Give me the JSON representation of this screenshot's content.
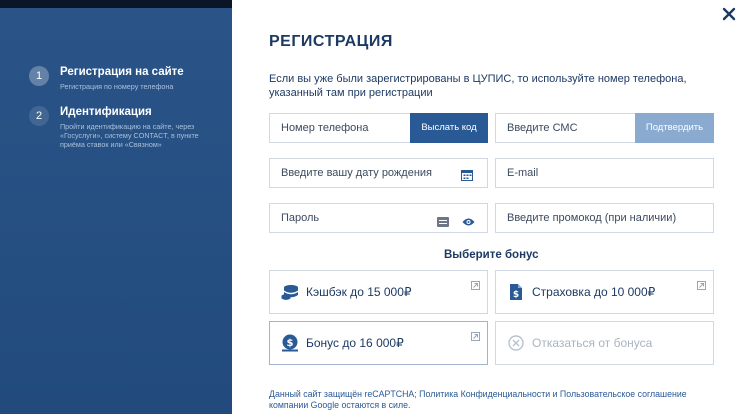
{
  "colors": {
    "sidebar": "#2a5488",
    "primary": "#2a5a96",
    "primary_light": "#8aaad0",
    "text_dark": "#1d3a63",
    "border": "#cfd8e3"
  },
  "sidebar": {
    "steps": [
      {
        "number": "1",
        "title": "Регистрация на сайте",
        "subtitle": "Регистрация по номеру телефона"
      },
      {
        "number": "2",
        "title": "Идентификация",
        "subtitle": "Пройти идентификацию на сайте, через «Госуслуги», систему CONTACT, в пункте приёма ставок или «Связном»"
      }
    ]
  },
  "modal": {
    "title": "РЕГИСТРАЦИЯ",
    "intro": "Если вы уже были зарегистрированы в ЦУПИС, то используйте номер телефона, указанный там при регистрации",
    "close_icon": "close-icon",
    "fields": {
      "phone": {
        "placeholder": "Номер телефона",
        "button": "Выслать код"
      },
      "sms": {
        "placeholder": "Введите СМС",
        "button": "Подтвердить"
      },
      "birthdate": {
        "placeholder": "Введите вашу дату рождения",
        "icon": "calendar-icon"
      },
      "email": {
        "placeholder": "E-mail"
      },
      "password": {
        "placeholder": "Пароль",
        "icon": "eye-icon"
      },
      "promo": {
        "placeholder": "Введите промокод (при наличии)"
      }
    },
    "bonus_title": "Выберите бонус",
    "bonuses": [
      {
        "label": "Кэшбэк до 15 000₽",
        "icon": "coins-icon"
      },
      {
        "label": "Страховка до 10 000₽",
        "icon": "document-dollar-icon"
      },
      {
        "label": "Бонус до 16 000₽",
        "icon": "money-bag-icon",
        "selected": true
      },
      {
        "label": "Отказаться от бонуса",
        "icon": "cancel-circle-icon"
      }
    ],
    "footer": "Данный сайт защищён reCAPTCHA; Политика Конфиденциальности и Пользовательское соглашение компании Google остаются в силе."
  }
}
